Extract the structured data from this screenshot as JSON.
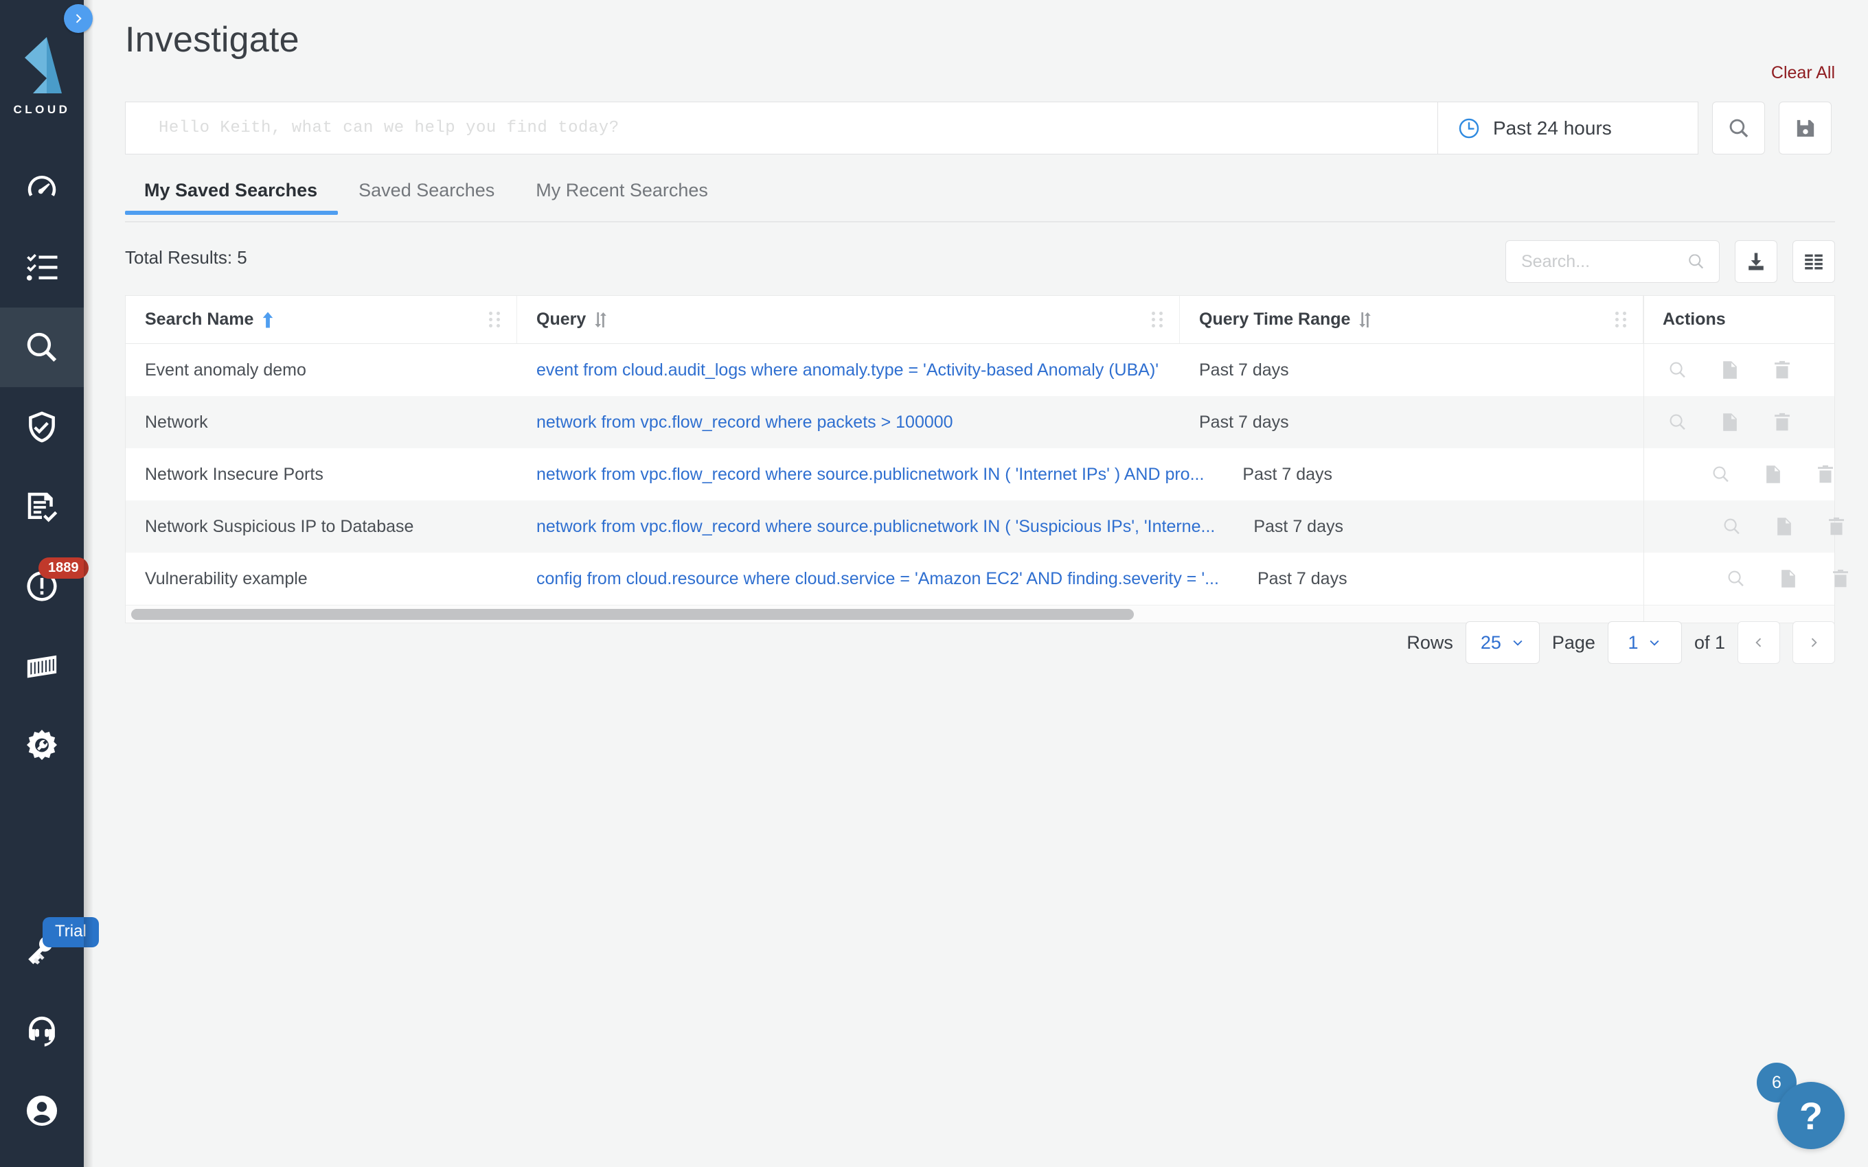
{
  "sidebar": {
    "logo_text": "CLOUD",
    "collapse_icon": "chevron-right-icon",
    "items": [
      {
        "icon": "speedometer-icon",
        "name": "dashboard",
        "active": false
      },
      {
        "icon": "checklist-icon",
        "name": "inventory",
        "active": false
      },
      {
        "icon": "magnifier-icon",
        "name": "investigate",
        "active": true
      },
      {
        "icon": "shield-check-icon",
        "name": "compliance",
        "active": false
      },
      {
        "icon": "document-check-icon",
        "name": "policies",
        "active": false
      },
      {
        "icon": "alert-circle-icon",
        "name": "alerts",
        "active": false,
        "badge": "1889"
      },
      {
        "icon": "container-icon",
        "name": "containers",
        "active": false
      },
      {
        "icon": "gear-wrench-icon",
        "name": "settings",
        "active": false
      },
      {
        "icon": "keys-icon",
        "name": "licensing",
        "active": false,
        "pill": "Trial"
      },
      {
        "icon": "headset-icon",
        "name": "support",
        "active": false
      },
      {
        "icon": "user-circle-icon",
        "name": "profile",
        "active": false
      }
    ]
  },
  "header": {
    "title": "Investigate",
    "clear_all_label": "Clear All",
    "clear_all_color": "#8f1d21"
  },
  "search": {
    "placeholder": "Hello Keith, what can we help you find today?",
    "value": "",
    "time_range_label": "Past 24 hours",
    "time_range_icon": "clock-icon",
    "run_search_icon": "search-icon",
    "save_icon": "floppy-save-icon"
  },
  "tabs": [
    {
      "label": "My Saved Searches",
      "active": true
    },
    {
      "label": "Saved Searches",
      "active": false
    },
    {
      "label": "My Recent Searches",
      "active": false
    }
  ],
  "table_toolbar": {
    "total_results": "Total Results: 5",
    "search_placeholder": "Search...",
    "search_value": "",
    "search_icon": "search-icon",
    "download_icon": "download-icon",
    "columns_icon": "column-layout-icon"
  },
  "table": {
    "columns": [
      {
        "label": "Search Name",
        "sort": "asc",
        "sort_icon": "arrow-up-icon",
        "grip": true
      },
      {
        "label": "Query",
        "sort": "none",
        "sort_icon": "sort-updown-icon",
        "grip": true
      },
      {
        "label": "Query Time Range",
        "sort": "none",
        "sort_icon": "sort-updown-icon",
        "grip": true
      },
      {
        "label": "Actions",
        "sort": null,
        "sort_icon": null,
        "grip": false
      }
    ],
    "row_action_icons": [
      "magnifier-icon",
      "file-plus-icon",
      "trash-icon"
    ],
    "rows": [
      {
        "name": "Event anomaly demo",
        "query": "event from cloud.audit_logs where anomaly.type = 'Activity-based Anomaly (UBA)'",
        "time_range": "Past 7 days"
      },
      {
        "name": "Network",
        "query": "network from vpc.flow_record where packets > 100000",
        "time_range": "Past 7 days"
      },
      {
        "name": "Network Insecure Ports",
        "query": "network from vpc.flow_record where source.publicnetwork IN ( 'Internet IPs' ) AND pro...",
        "time_range": "Past 7 days"
      },
      {
        "name": "Network Suspicious IP to Database",
        "query": "network from vpc.flow_record where source.publicnetwork IN ( 'Suspicious IPs', 'Interne...",
        "time_range": "Past 7 days"
      },
      {
        "name": "Vulnerability example",
        "query": "config from cloud.resource where cloud.service = 'Amazon EC2' AND finding.severity = '...",
        "time_range": "Past 7 days"
      }
    ]
  },
  "pagination": {
    "rows_label": "Rows",
    "rows_value": "25",
    "page_label": "Page",
    "page_value": "1",
    "of_label": "of 1",
    "prev_icon": "chevron-left-icon",
    "next_icon": "chevron-right-icon"
  },
  "help": {
    "icon": "question-mark-icon",
    "symbol": "?",
    "count": "6",
    "color": "#3781b8"
  }
}
